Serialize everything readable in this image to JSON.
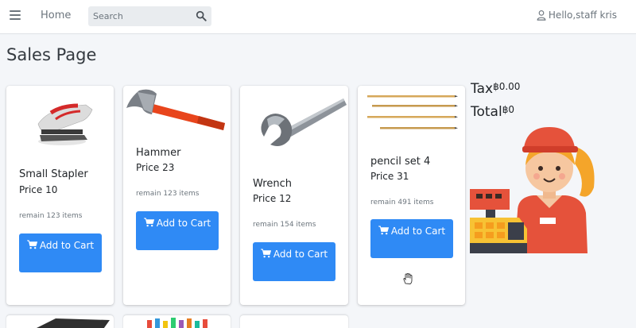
{
  "navbar": {
    "home_label": "Home",
    "search_placeholder": "Search",
    "user_label": "Hello,staff kris"
  },
  "page": {
    "title": "Sales Page"
  },
  "products": [
    {
      "name": "Small Stapler",
      "price": "Price 10",
      "remain": "remain 123 items",
      "button_label": "Add to Cart",
      "image": "stapler"
    },
    {
      "name": "Hammer",
      "price": "Price 23",
      "remain": "remain 123 items",
      "button_label": "Add to Cart",
      "image": "hammer"
    },
    {
      "name": "Wrench",
      "price": "Price 12",
      "remain": "remain 154 items",
      "button_label": "Add to Cart",
      "image": "wrench"
    },
    {
      "name": "pencil set 4",
      "price": "Price 31",
      "remain": "remain 491 items",
      "button_label": "Add to Cart",
      "image": "pencils"
    }
  ],
  "summary": {
    "tax_label": "Tax",
    "tax_value": "฿0.00",
    "total_label": "Total",
    "total_value": "฿0"
  },
  "colors": {
    "primary": "#2f8af5",
    "background": "#f4f6f9",
    "muted": "#6c757d"
  },
  "icons": [
    "menu-icon",
    "search-icon",
    "user-icon",
    "cart-icon",
    "cashier-illustration",
    "hand-cursor-icon"
  ]
}
